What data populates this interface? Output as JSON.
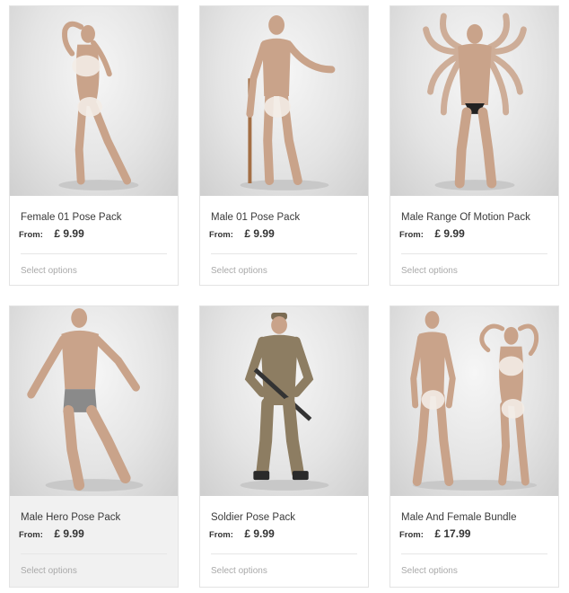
{
  "products": [
    {
      "name": "Female 01 Pose Pack",
      "from_label": "From:",
      "price": "£ 9.99",
      "action": "Select options",
      "figure": "female-figure-image"
    },
    {
      "name": "Male 01 Pose Pack",
      "from_label": "From:",
      "price": "£ 9.99",
      "action": "Select options",
      "figure": "male-figure-with-staff-image"
    },
    {
      "name": "Male Range Of Motion Pack",
      "from_label": "From:",
      "price": "£ 9.99",
      "action": "Select options",
      "figure": "multi-arm-male-figure-image"
    },
    {
      "name": "Male Hero Pose Pack",
      "from_label": "From:",
      "price": "£ 9.99",
      "action": "Select options",
      "figure": "male-hero-figure-image"
    },
    {
      "name": "Soldier Pose Pack",
      "from_label": "From:",
      "price": "£ 9.99",
      "action": "Select options",
      "figure": "soldier-figure-image"
    },
    {
      "name": "Male And Female Bundle",
      "from_label": "From:",
      "price": "£ 17.99",
      "action": "Select options",
      "figure": "male-and-female-figures-image"
    }
  ],
  "colors": {
    "skin": "#c9a38a",
    "skin_shadow": "#a9826a",
    "blur": "#f3ece6",
    "camo": "#8d7d62",
    "card_border": "#e3e3e3"
  }
}
